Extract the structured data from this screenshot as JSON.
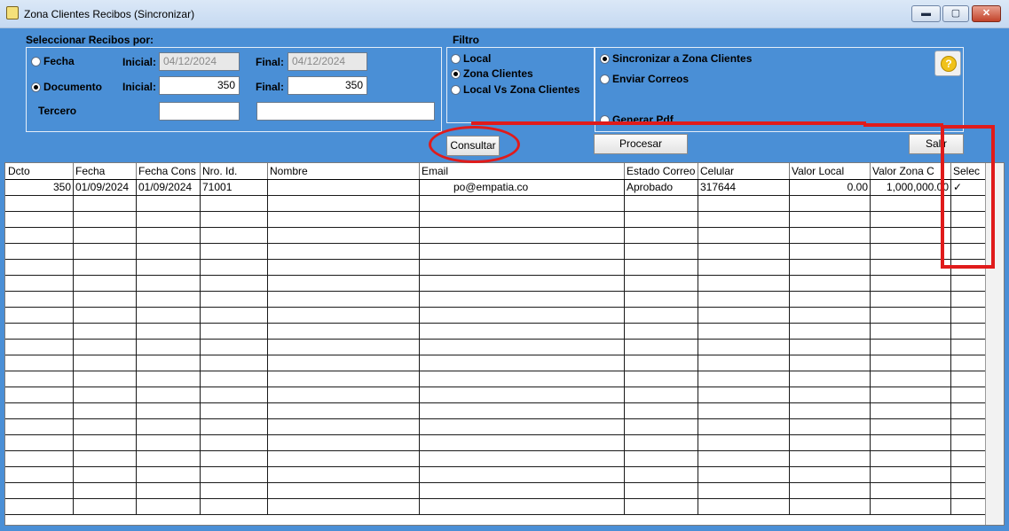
{
  "window": {
    "title": "Zona Clientes Recibos (Sincronizar)",
    "minimize": "▬",
    "maximize": "▢",
    "close": "✕"
  },
  "seleccion": {
    "heading": "Seleccionar Recibos por:",
    "fecha_label": "Fecha",
    "documento_label": "Documento",
    "tercero_label": "Tercero",
    "inicial_label": "Inicial:",
    "final_label": "Final:",
    "fecha_inicial": "04/12/2024",
    "fecha_final": "04/12/2024",
    "doc_inicial": "350",
    "doc_final": "350",
    "tercero_id": "",
    "tercero_nombre": ""
  },
  "filtro": {
    "heading": "Filtro",
    "options": [
      "Local",
      "Zona Clientes",
      "Local Vs Zona Clientes"
    ],
    "selected": "Zona Clientes"
  },
  "acciones": {
    "options": [
      "Sincronizar a Zona Clientes",
      "Enviar Correos",
      "Generar Pdf"
    ],
    "selected": "Sincronizar a Zona Clientes",
    "help_icon": "?"
  },
  "buttons": {
    "consultar": "Consultar",
    "procesar": "Procesar",
    "salir": "Salir"
  },
  "grid": {
    "columns": [
      "Dcto",
      "Fecha",
      "Fecha Cons",
      "Nro. Id.",
      "Nombre",
      "Email",
      "Estado Correo",
      "Celular",
      "Valor Local",
      "Valor Zona C",
      "Selec"
    ],
    "rows": [
      [
        "350",
        "01/09/2024",
        "01/09/2024",
        "71001",
        "",
        "po@empatia.co",
        "Aprobado",
        "317644",
        "0.00",
        "1,000,000.00",
        "✓"
      ]
    ]
  },
  "colors": {
    "window_bg": "#4a8fd6",
    "annotation_red": "#e01b1b"
  }
}
